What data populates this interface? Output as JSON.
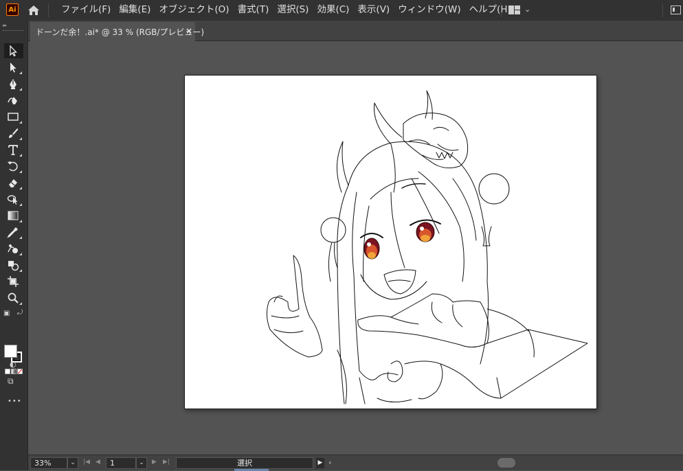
{
  "app": {
    "logo_text": "Ai"
  },
  "menu": {
    "items": [
      "ファイル(F)",
      "編集(E)",
      "オブジェクト(O)",
      "書式(T)",
      "選択(S)",
      "効果(C)",
      "表示(V)",
      "ウィンドウ(W)",
      "ヘルプ(H)"
    ]
  },
  "document_tab": {
    "title": "ドーンだ余！.ai* @ 33 % (RGB/プレビュー)",
    "close_glyph": "×"
  },
  "tools": [
    "selection-tool",
    "direct-selection-tool",
    "pen-tool",
    "curvature-tool",
    "rectangle-tool",
    "paintbrush-tool",
    "type-tool",
    "rotate-tool",
    "eraser-tool",
    "puppet-warp-tool",
    "gradient-tool",
    "eyedropper-tool",
    "blend-tool",
    "shape-builder-tool",
    "artboard-tool",
    "zoom-tool"
  ],
  "colors": {
    "fill": "#ffffff",
    "stroke": "#000000",
    "accent": "#ff7c00",
    "app_bg": "#535353",
    "chrome": "#323232"
  },
  "statusbar": {
    "zoom": "33%",
    "artboard_number": "1",
    "current_tool": "選択"
  },
  "toolbar_more": "•••"
}
